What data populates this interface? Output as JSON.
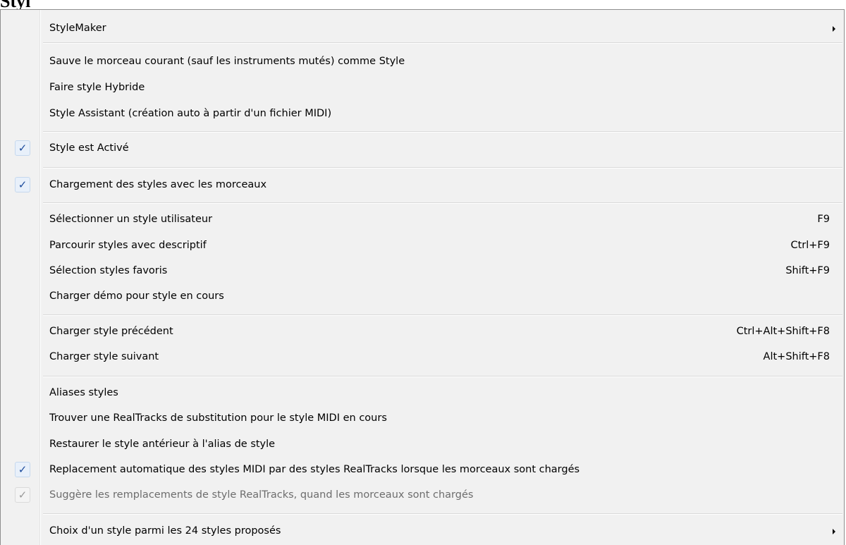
{
  "menu": {
    "title": "Styl"
  },
  "items": {
    "stylemaker": {
      "label": "StyleMaker"
    },
    "save_as_style": {
      "label": "Sauve le morceau courant (sauf les instruments mutés) comme Style"
    },
    "hybrid_style": {
      "label": "Faire style Hybride"
    },
    "style_assistant": {
      "label": "Style Assistant (création auto à partir d'un fichier MIDI)"
    },
    "style_enabled": {
      "label": "Style est Activé",
      "checked": true
    },
    "load_styles_with_songs": {
      "label": "Chargement des styles avec les morceaux",
      "checked": true
    },
    "select_user_style": {
      "label": "Sélectionner un style utilisateur",
      "shortcut": "F9"
    },
    "browse_styles": {
      "label": "Parcourir styles avec descriptif",
      "shortcut": "Ctrl+F9"
    },
    "favorite_styles": {
      "label": "Sélection styles favoris",
      "shortcut": "Shift+F9"
    },
    "load_demo": {
      "label": "Charger démo pour style en cours"
    },
    "previous_style": {
      "label": "Charger style précédent",
      "shortcut": "Ctrl+Alt+Shift+F8"
    },
    "next_style": {
      "label": "Charger style suivant",
      "shortcut": "Alt+Shift+F8"
    },
    "style_aliases": {
      "label": "Aliases styles"
    },
    "find_realtracks_substitute": {
      "label": "Trouver une RealTracks de substitution pour le style MIDI en cours"
    },
    "restore_previous_style": {
      "label": "Restaurer le style antérieur à l'alias de style"
    },
    "auto_replace_midi_styles": {
      "label": "Replacement automatique des styles MIDI par des styles RealTracks lorsque les morceaux sont chargés",
      "checked": true
    },
    "suggest_realtracks_replacements": {
      "label": "Suggère les remplacements de style RealTracks, quand les morceaux sont chargés",
      "checked": true,
      "disabled": true
    },
    "choose_from_24_styles": {
      "label": "Choix d'un style parmi les 24 styles proposés"
    }
  },
  "icons": {
    "checkmark": "✓",
    "submenu_arrow": "submenu-arrow-icon"
  },
  "colors": {
    "menu_background": "#f1f1f1",
    "check_background": "#e8f0fa",
    "check_color": "#1c4b9c",
    "disabled_text": "#6d6d6d"
  }
}
